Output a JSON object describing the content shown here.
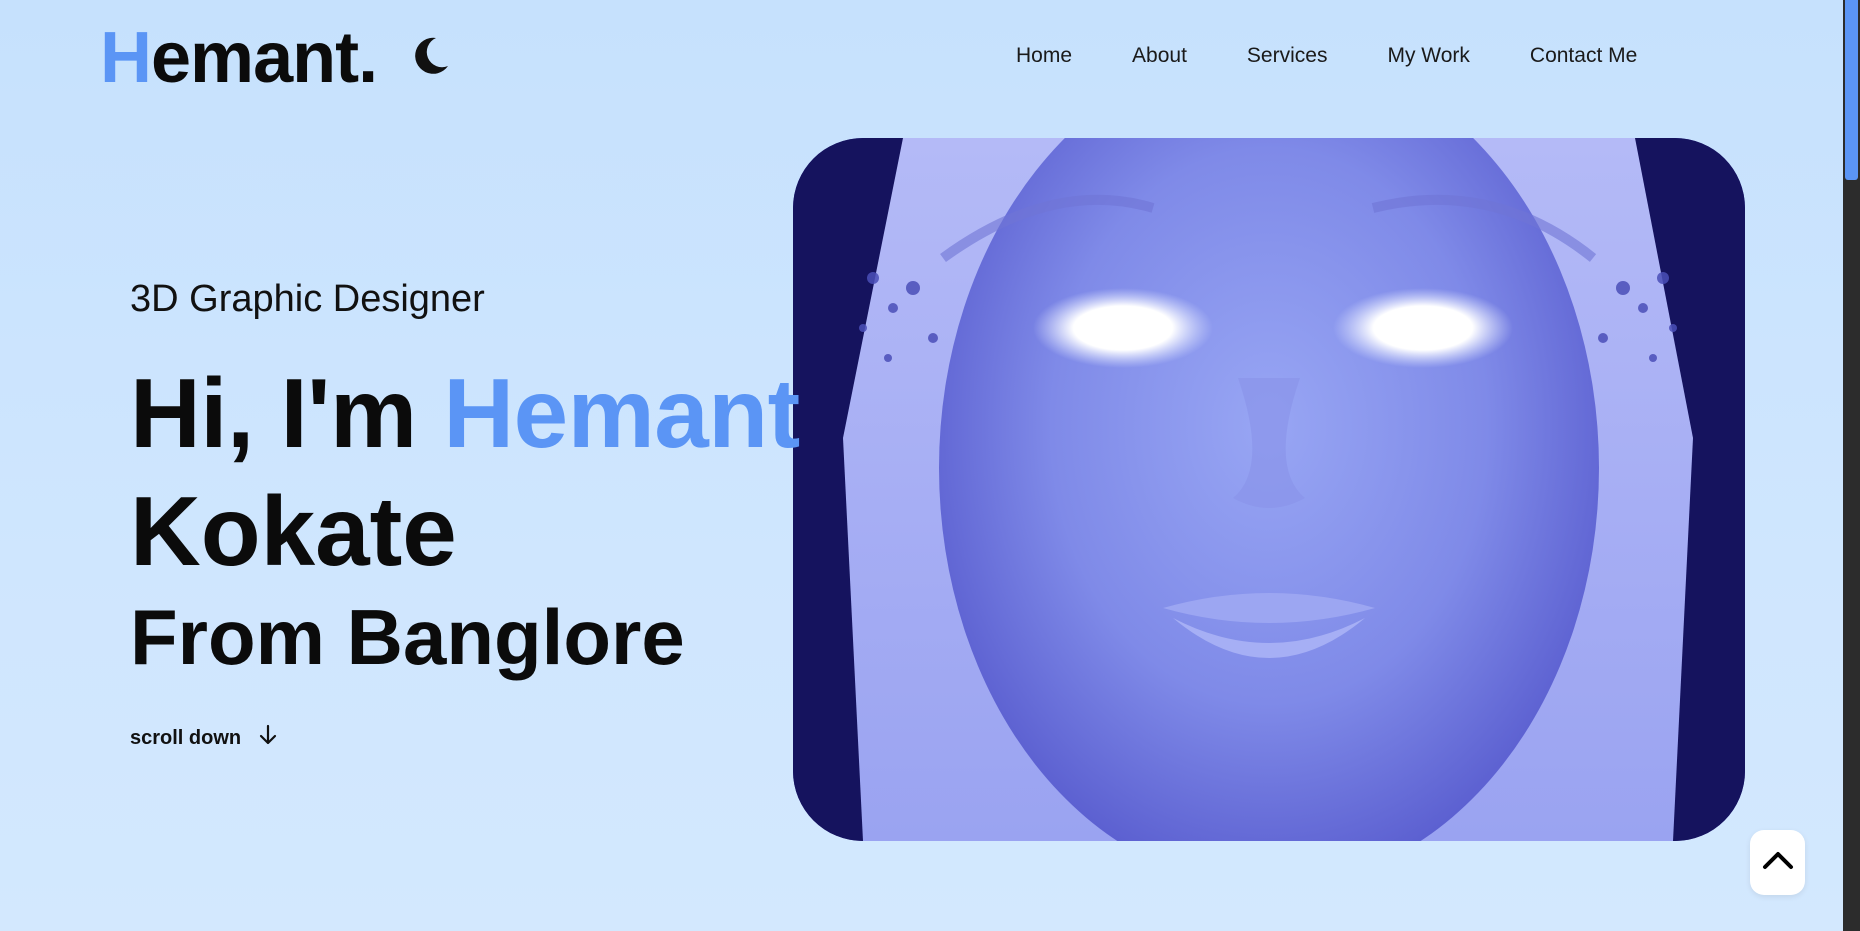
{
  "brand": {
    "first_letter": "H",
    "rest": "emant.",
    "accent_color": "#5b95f5"
  },
  "theme_toggle": {
    "icon": "moon-icon"
  },
  "nav": {
    "items": [
      "Home",
      "About",
      "Services",
      "My Work",
      "Contact Me"
    ]
  },
  "hero": {
    "subtitle": "3D Graphic Designer",
    "greeting": "Hi, I'm ",
    "highlight_name": "Hemant",
    "line2": "Kokate",
    "line3": "From Banglore",
    "scroll_label": "scroll down",
    "scroll_icon": "arrow-down-icon",
    "image_subject": "glowing-eyed-3d-face"
  },
  "back_to_top": {
    "icon": "chevron-up-icon"
  },
  "colors": {
    "background": "#c6e1fd",
    "text": "#0b0b0b",
    "scrollbar_thumb": "#5b95f5"
  }
}
